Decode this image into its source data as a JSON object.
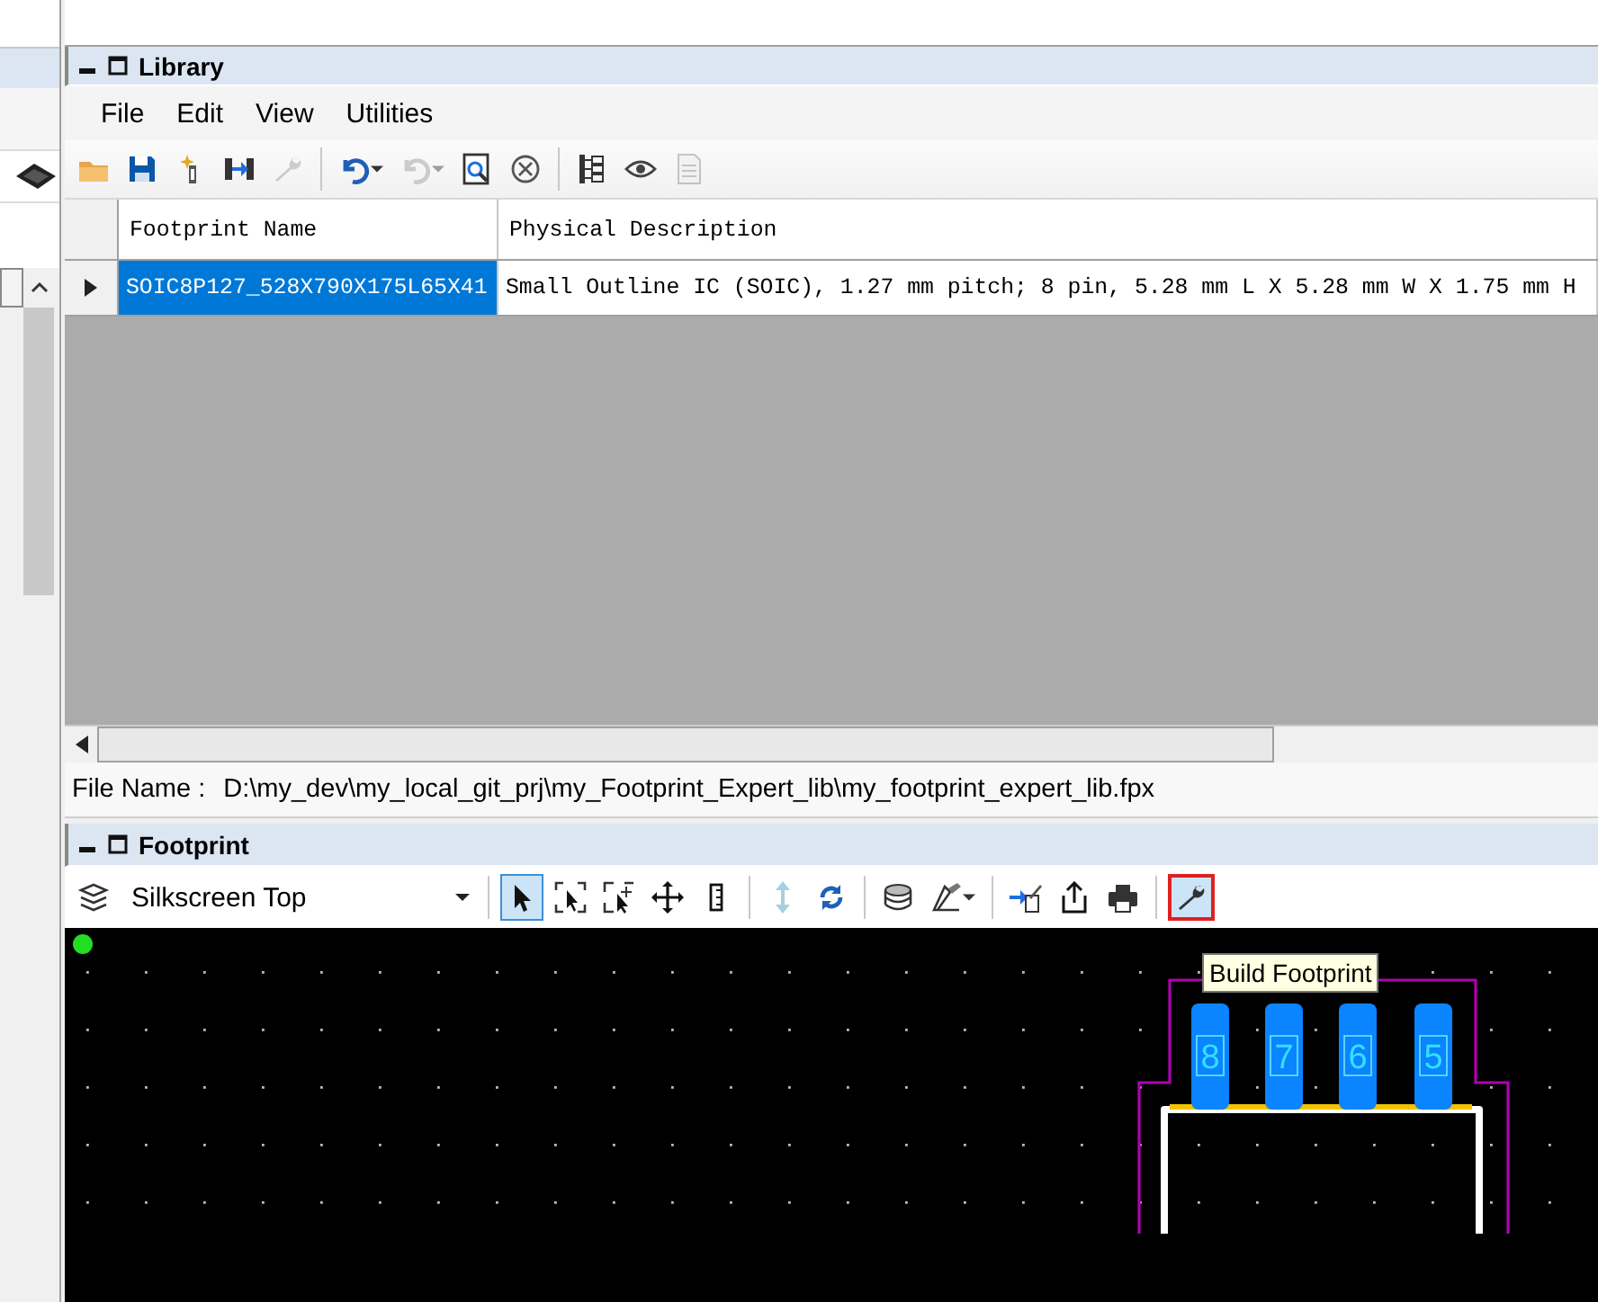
{
  "library": {
    "title": "Library",
    "menu": [
      "File",
      "Edit",
      "View",
      "Utilities"
    ],
    "toolbar": [
      {
        "kind": "button",
        "selected": false,
        "disabled": false
      },
      {
        "kind": "button",
        "selected": false,
        "disabled": false
      },
      {
        "kind": "button",
        "selected": false,
        "disabled": false
      },
      {
        "kind": "button",
        "selected": false,
        "disabled": false
      },
      {
        "kind": "button",
        "selected": false,
        "disabled": true
      },
      {
        "kind": "separator"
      },
      {
        "kind": "button",
        "selected": false,
        "disabled": false,
        "dropdown": true
      },
      {
        "kind": "button",
        "selected": false,
        "disabled": true,
        "dropdown": true
      },
      {
        "kind": "button",
        "selected": false,
        "disabled": false
      },
      {
        "kind": "button",
        "selected": false,
        "disabled": false
      },
      {
        "kind": "separator"
      },
      {
        "kind": "button",
        "selected": false,
        "disabled": false
      },
      {
        "kind": "button",
        "selected": false,
        "disabled": false
      },
      {
        "kind": "button",
        "selected": false,
        "disabled": true
      }
    ],
    "table": {
      "columns": [
        "Footprint Name",
        "Physical Description"
      ],
      "rows": [
        {
          "selected": true,
          "cells": [
            "SOIC8P127_528X790X175L65X41",
            "Small Outline IC (SOIC), 1.27 mm pitch; 8 pin, 5.28 mm L X 5.28 mm W X 1.75 mm H"
          ]
        }
      ]
    },
    "file_name": {
      "label": "File Name :",
      "value": "D:\\my_dev\\my_local_git_prj\\my_Footprint_Expert_lib\\my_footprint_expert_lib.fpx"
    }
  },
  "footprint": {
    "title": "Footprint",
    "layer": {
      "value": "Silkscreen Top"
    },
    "toolbar": [
      {
        "kind": "separator"
      },
      {
        "kind": "button",
        "selected": true,
        "disabled": false
      },
      {
        "kind": "button",
        "selected": false,
        "disabled": false
      },
      {
        "kind": "button",
        "selected": false,
        "disabled": false
      },
      {
        "kind": "button",
        "selected": false,
        "disabled": false
      },
      {
        "kind": "button",
        "selected": false,
        "disabled": false
      },
      {
        "kind": "separator"
      },
      {
        "kind": "button",
        "selected": false,
        "disabled": true
      },
      {
        "kind": "button",
        "selected": false,
        "disabled": false
      },
      {
        "kind": "separator"
      },
      {
        "kind": "button",
        "selected": false,
        "disabled": false
      },
      {
        "kind": "button",
        "selected": false,
        "disabled": false,
        "dropdown": true
      },
      {
        "kind": "separator"
      },
      {
        "kind": "button",
        "selected": false,
        "disabled": false
      },
      {
        "kind": "button",
        "selected": false,
        "disabled": false
      },
      {
        "kind": "button",
        "selected": false,
        "disabled": false
      },
      {
        "kind": "separator"
      },
      {
        "kind": "button",
        "selected": true,
        "disabled": false,
        "highlighted": true
      }
    ],
    "tooltip": "Build Footprint",
    "pads": [
      "8",
      "7",
      "6",
      "5"
    ]
  }
}
